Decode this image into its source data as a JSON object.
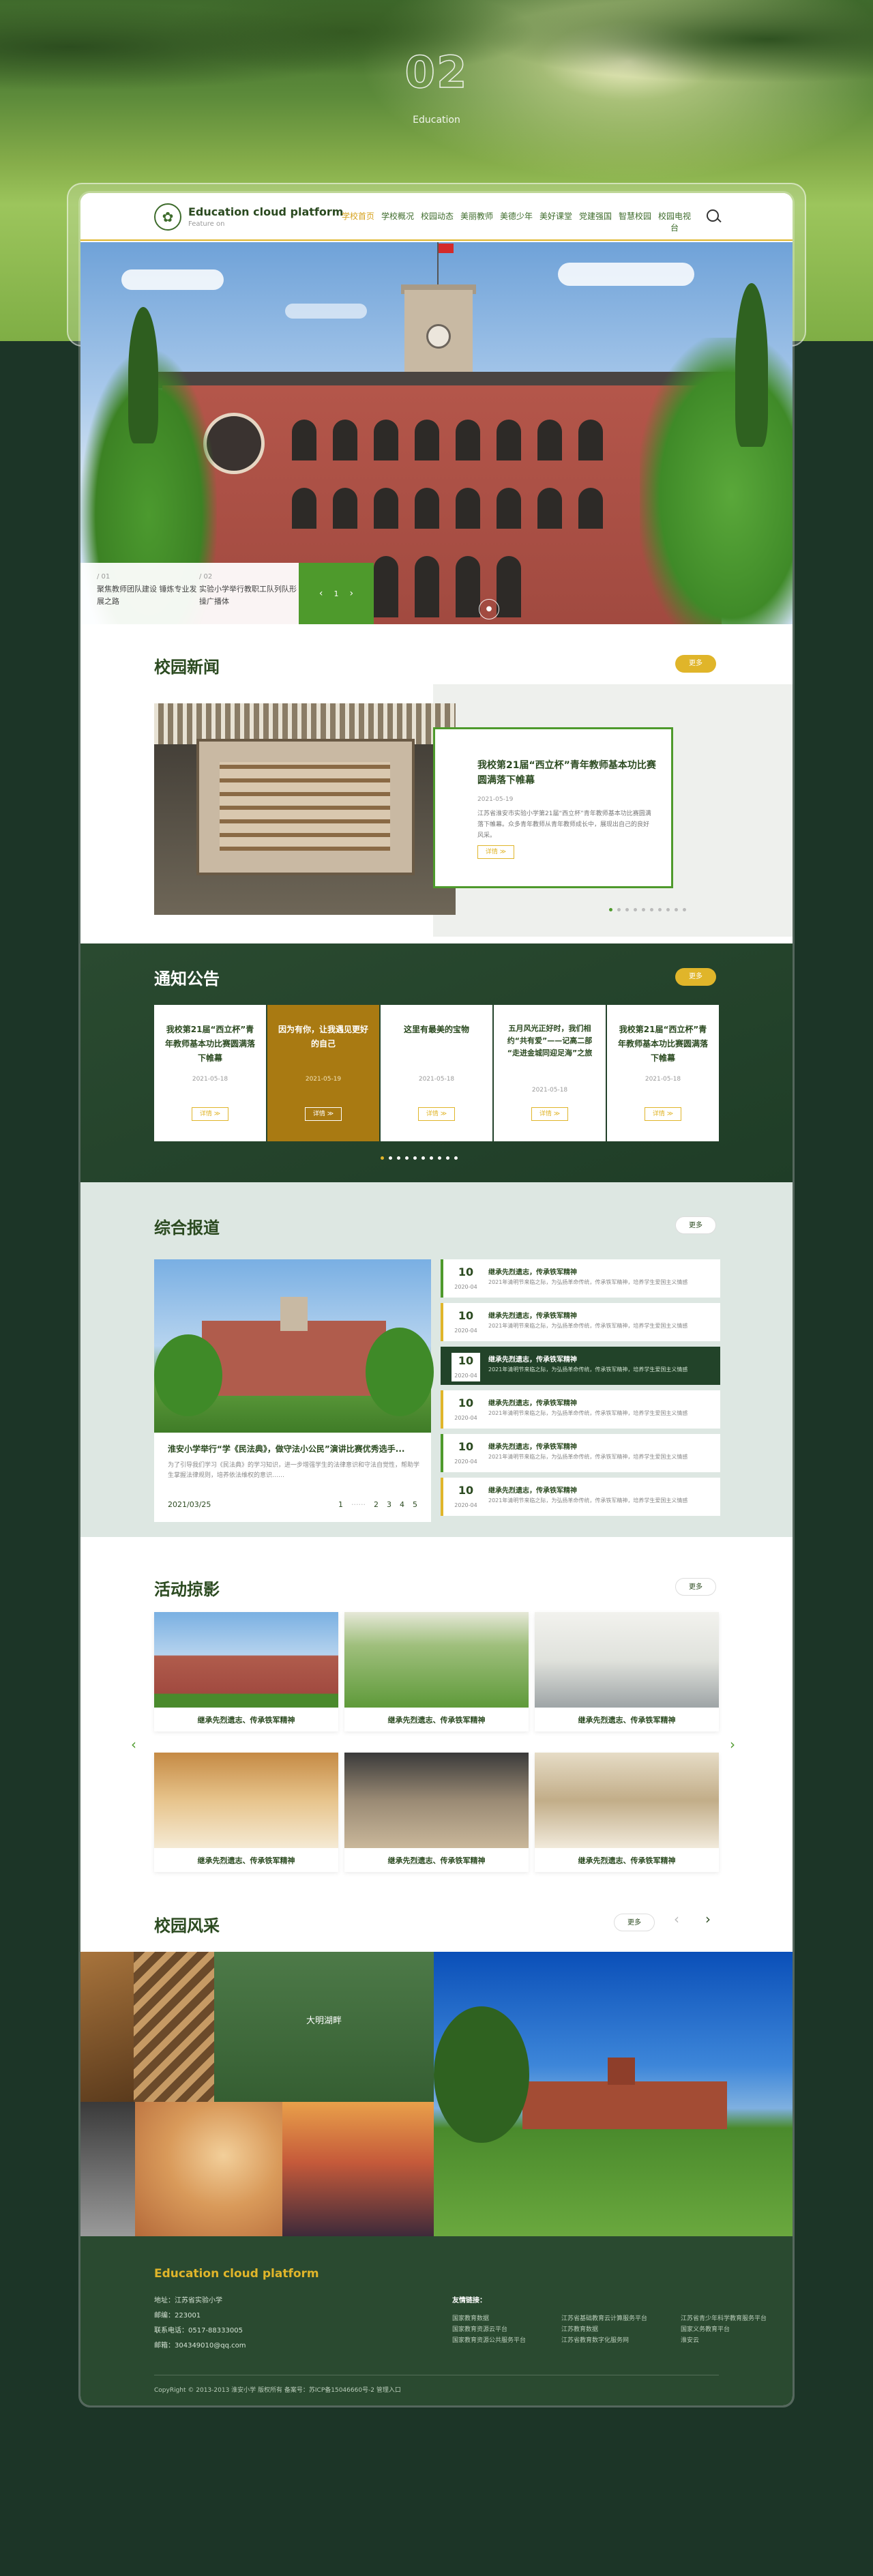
{
  "hero": {
    "number": "02",
    "subtitle": "Education"
  },
  "header": {
    "logo_title": "Education cloud platform",
    "logo_sub": "Feature on",
    "nav": [
      "学校首页",
      "学校概况",
      "校园动态",
      "美丽教师",
      "美德少年",
      "美好课堂",
      "党建强国",
      "智慧校园",
      "校园电视台"
    ]
  },
  "banner": {
    "captions": [
      {
        "num": "/ 01",
        "text": "聚焦教师团队建设 锤炼专业发展之路"
      },
      {
        "num": "/ 02",
        "text": "实验小学举行教职工队列队形操广播体"
      }
    ],
    "prev": "‹",
    "page": "1",
    "next": "›",
    "circle": "●"
  },
  "news": {
    "title": "校园新闻",
    "more": "更多",
    "headline": "我校第21届“西立杯”青年教师基本功比赛圆满落下帷幕",
    "date": "2021-05-19",
    "excerpt": "江苏省淮安市实验小学第21届“西立杯”青年教师基本功比赛圆满落下帷幕。众多青年教师从青年教师成长中，展现出自己的良好风采。",
    "detail": "详情 ≫"
  },
  "notice": {
    "title": "通知公告",
    "more": "更多",
    "cards": [
      {
        "title": "我校第21届“西立杯”青年教师基本功比赛圆满落下帷幕",
        "date": "2021-05-18",
        "btn": "详情 ≫"
      },
      {
        "title": "因为有你，让我遇见更好的自己",
        "date": "2021-05-19",
        "btn": "详情 ≫"
      },
      {
        "title": "这里有最美的宝物",
        "date": "2021-05-18",
        "btn": "详情 ≫"
      },
      {
        "title": "五月风光正好时，我们相约“共有爱”——记高二部 “走进金城同迎足海”之旅",
        "date": "2021-05-18",
        "btn": "详情 ≫"
      },
      {
        "title": "我校第21届“西立杯”青年教师基本功比赛圆满落下帷幕",
        "date": "2021-05-18",
        "btn": "详情 ≫"
      }
    ]
  },
  "report": {
    "title": "综合报道",
    "more": "更多",
    "feature_title": "淮安小学举行“学《民法典》，做守法小公民”演讲比赛优秀选手...",
    "feature_text": "为了引导我们学习《民法典》的学习知识，进一步增强学生的法律意识和守法自觉性，帮助学生掌握法律规则，培养依法维权的意识……",
    "feature_date": "2021/03/25",
    "pager": [
      "1",
      "2",
      "3",
      "4",
      "5"
    ],
    "items": [
      {
        "day": "10",
        "ym": "2020-04",
        "title": "继承先烈遗志，传承铁军精神",
        "text": "2021年清明节来临之际，为弘扬革命传统，传承铁军精神，培养学生爱国主义情感"
      },
      {
        "day": "10",
        "ym": "2020-04",
        "title": "继承先烈遗志，传承铁军精神",
        "text": "2021年清明节来临之际，为弘扬革命传统，传承铁军精神，培养学生爱国主义情感"
      },
      {
        "day": "10",
        "ym": "2020-04",
        "title": "继承先烈遗志，传承铁军精神",
        "text": "2021年清明节来临之际，为弘扬革命传统，传承铁军精神，培养学生爱国主义情感"
      },
      {
        "day": "10",
        "ym": "2020-04",
        "title": "继承先烈遗志，传承铁军精神",
        "text": "2021年清明节来临之际，为弘扬革命传统，传承铁军精神，培养学生爱国主义情感"
      },
      {
        "day": "10",
        "ym": "2020-04",
        "title": "继承先烈遗志，传承铁军精神",
        "text": "2021年清明节来临之际，为弘扬革命传统，传承铁军精神，培养学生爱国主义情感"
      },
      {
        "day": "10",
        "ym": "2020-04",
        "title": "继承先烈遗志，传承铁军精神",
        "text": "2021年清明节来临之际，为弘扬革命传统，传承铁军精神，培养学生爱国主义情感"
      }
    ]
  },
  "activity": {
    "title": "活动掠影",
    "more": "更多",
    "cards": [
      "继承先烈遗志、传承铁军精神",
      "继承先烈遗志、传承铁军精神",
      "继承先烈遗志、传承铁军精神",
      "继承先烈遗志、传承铁军精神",
      "继承先烈遗志、传承铁军精神",
      "继承先烈遗志、传承铁军精神"
    ],
    "prev": "‹",
    "next": "›"
  },
  "campus": {
    "title": "校园风采",
    "more": "更多",
    "caption": "大明湖畔",
    "prev": "‹",
    "next": "›"
  },
  "footer": {
    "title": "Education cloud platform",
    "address": "地址：江苏省实验小学",
    "zip": "邮编：223001",
    "phone": "联系电话：0517-88333005",
    "email": "邮箱：304349010@qq.com",
    "links_title": "友情链接：",
    "links": [
      "国家教育数据",
      "江苏省基础教育云计算服务平台",
      "江苏省青少年科学教育服务平台",
      "国家教育资源云平台",
      "江苏教育数据",
      "国家义务教育平台",
      "国家教育资源公共服务平台",
      "江苏省教育数字化服务网",
      "淮安云"
    ],
    "copyright": "CopyRight © 2013-2013 淮安小学 版权所有 备案号：苏ICP备15046660号-2  管理入口"
  },
  "colors": {
    "green": "#2b4a20",
    "accent": "#4e9a2c",
    "gold": "#e0b52a",
    "dark": "#1c3527"
  }
}
